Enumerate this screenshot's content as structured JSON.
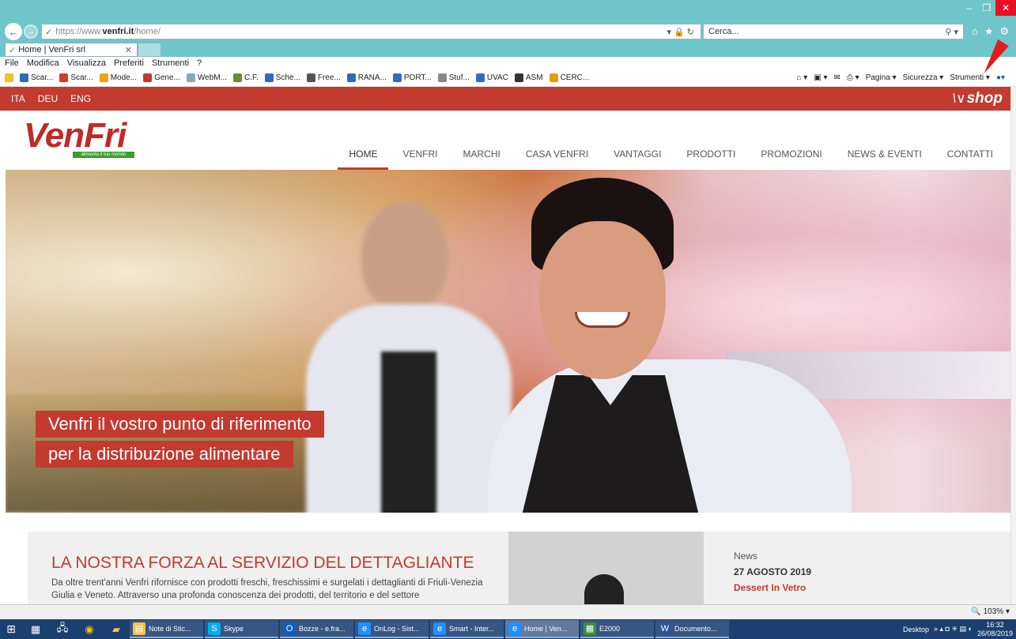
{
  "browser": {
    "url_prefix": "https://www.",
    "url_domain": "venfri.it",
    "url_path": "/home/",
    "search_placeholder": "Cerca...",
    "tab_title": "Home | VenFri srl",
    "menu": [
      "File",
      "Modifica",
      "Visualizza",
      "Preferiti",
      "Strumenti",
      "?"
    ],
    "favorites": [
      {
        "label": "Scar...",
        "color": "#2f6cc0"
      },
      {
        "label": "Scar...",
        "color": "#d23a2b"
      },
      {
        "label": "Mode...",
        "color": "#f2a11b"
      },
      {
        "label": "Gene...",
        "color": "#c0392b"
      },
      {
        "label": "WebM...",
        "color": "#8ab"
      },
      {
        "label": "C.F.",
        "color": "#6a8c2f"
      },
      {
        "label": "Sche...",
        "color": "#2f6cc0"
      },
      {
        "label": "Free...",
        "color": "#555"
      },
      {
        "label": "RANA...",
        "color": "#2f6cc0"
      },
      {
        "label": "PORT...",
        "color": "#2f6cc0"
      },
      {
        "label": "Stuf...",
        "color": "#888"
      },
      {
        "label": "UVAC",
        "color": "#2f6cc0"
      },
      {
        "label": "ASM",
        "color": "#333"
      },
      {
        "label": "CERC...",
        "color": "#e0a000"
      }
    ],
    "tools": [
      "Pagina ▾",
      "Sicurezza ▾",
      "Strumenti ▾"
    ],
    "zoom": "103%"
  },
  "site": {
    "languages": [
      "ITA",
      "DEU",
      "ENG"
    ],
    "shop_label": "shop",
    "logo_text": "VenFri",
    "logo_tagline": "alimenta il tuo mondo",
    "nav": [
      "HOME",
      "VENFRI",
      "MARCHI",
      "CASA VENFRI",
      "VANTAGGI",
      "PRODOTTI",
      "PROMOZIONI",
      "NEWS & EVENTI",
      "CONTATTI"
    ],
    "hero_caption_1": "Venfri il vostro punto di riferimento",
    "hero_caption_2": "per la distribuzione alimentare",
    "section_title": "LA NOSTRA FORZA AL SERVIZIO DEL DETTAGLIANTE",
    "section_text": "Da oltre trent'anni Venfri rifornisce con prodotti freschi, freschissimi e surgelati i dettaglianti di Friuli-Venezia Giulia e Veneto. Attraverso una profonda conoscenza dei prodotti, del territorio e del settore",
    "news_label": "News",
    "news_date": "27 AGOSTO 2019",
    "news_title": "Dessert In Vetro"
  },
  "taskbar": {
    "apps": [
      {
        "label": "Note di Stic...",
        "icon": "note-icon",
        "color": "#f3c34b"
      },
      {
        "label": "Skype",
        "icon": "skype-icon",
        "color": "#00aff0"
      },
      {
        "label": "Bozze - e.fra...",
        "icon": "outlook-icon",
        "color": "#0f5fbf"
      },
      {
        "label": "OnLog - Sist...",
        "icon": "ie-icon",
        "color": "#1e90ff"
      },
      {
        "label": "Smart - Inter...",
        "icon": "ie-icon",
        "color": "#1e90ff"
      },
      {
        "label": "Home | Ven...",
        "icon": "ie-icon",
        "color": "#1e90ff"
      },
      {
        "label": "E2000",
        "icon": "grid-icon",
        "color": "#3b8f3b"
      },
      {
        "label": "Documento...",
        "icon": "word-icon",
        "color": "#2b5797"
      }
    ],
    "desktop_label": "Desktop",
    "time": "16:32",
    "date": "26/08/2019"
  }
}
